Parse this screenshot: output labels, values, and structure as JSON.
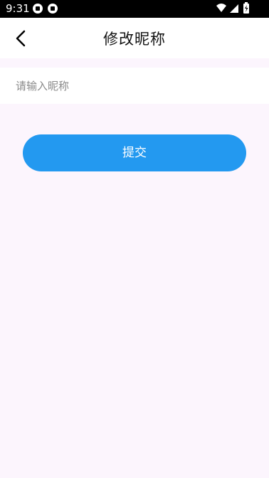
{
  "status_bar": {
    "time": "9:31",
    "icons": [
      "notification-icon",
      "notification-icon",
      "wifi-icon",
      "signal-icon",
      "battery-charging-icon"
    ]
  },
  "header": {
    "back_icon": "chevron-left-icon",
    "title": "修改昵称"
  },
  "form": {
    "nickname": {
      "value": "",
      "placeholder": "请输入昵称"
    },
    "submit_label": "提交"
  },
  "colors": {
    "background": "#fcf5fd",
    "header_bg": "#ffffff",
    "accent": "#2399f0",
    "status_bar": "#000000"
  }
}
